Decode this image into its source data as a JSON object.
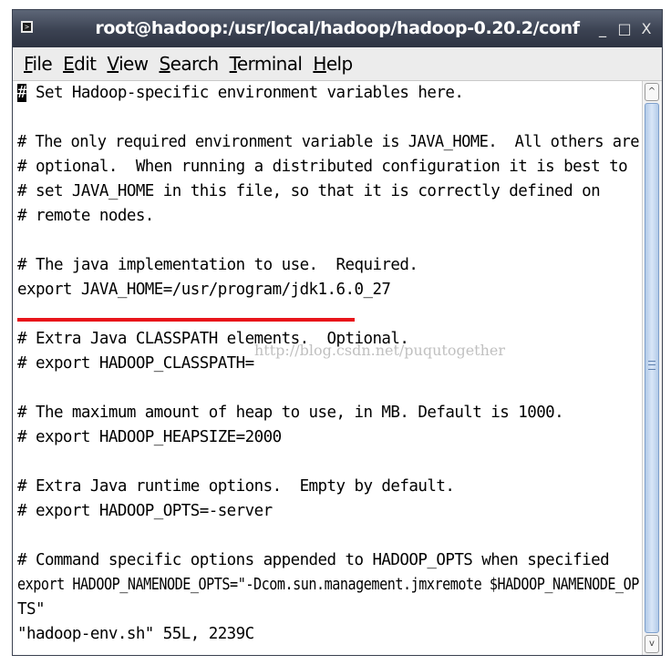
{
  "window": {
    "title": "root@hadoop:/usr/local/hadoop/hadoop-0.20.2/conf",
    "controls": {
      "minimize": "_",
      "maximize": "□",
      "close": "X"
    }
  },
  "menubar": {
    "items": [
      {
        "mnemonic": "F",
        "rest": "ile"
      },
      {
        "mnemonic": "E",
        "rest": "dit"
      },
      {
        "mnemonic": "V",
        "rest": "iew"
      },
      {
        "mnemonic": "S",
        "rest": "earch"
      },
      {
        "mnemonic": "T",
        "rest": "erminal"
      },
      {
        "mnemonic": "H",
        "rest": "elp"
      }
    ]
  },
  "terminal": {
    "cursor_char": "#",
    "lines": [
      " Set Hadoop-specific environment variables here.",
      "",
      "# The only required environment variable is JAVA_HOME.  All others are",
      "# optional.  When running a distributed configuration it is best to",
      "# set JAVA_HOME in this file, so that it is correctly defined on",
      "# remote nodes.",
      "",
      "# The java implementation to use.  Required.",
      "export JAVA_HOME=/usr/program/jdk1.6.0_27",
      "",
      "# Extra Java CLASSPATH elements.  Optional.",
      "# export HADOOP_CLASSPATH=",
      "",
      "# The maximum amount of heap to use, in MB. Default is 1000.",
      "# export HADOOP_HEAPSIZE=2000",
      "",
      "# Extra Java runtime options.  Empty by default.",
      "# export HADOOP_OPTS=-server",
      "",
      "# Command specific options appended to HADOOP_OPTS when specified",
      "export HADOOP_NAMENODE_OPTS=\"-Dcom.sun.management.jmxremote $HADOOP_NAMENODE_OP",
      "TS\"",
      "\"hadoop-env.sh\" 55L, 2239C"
    ],
    "watermark": "http://blog.csdn.net/puqutogether",
    "highlight_color": "#e8141a"
  },
  "scrollbar": {
    "up": "^",
    "down": "v",
    "grip": "≡"
  }
}
